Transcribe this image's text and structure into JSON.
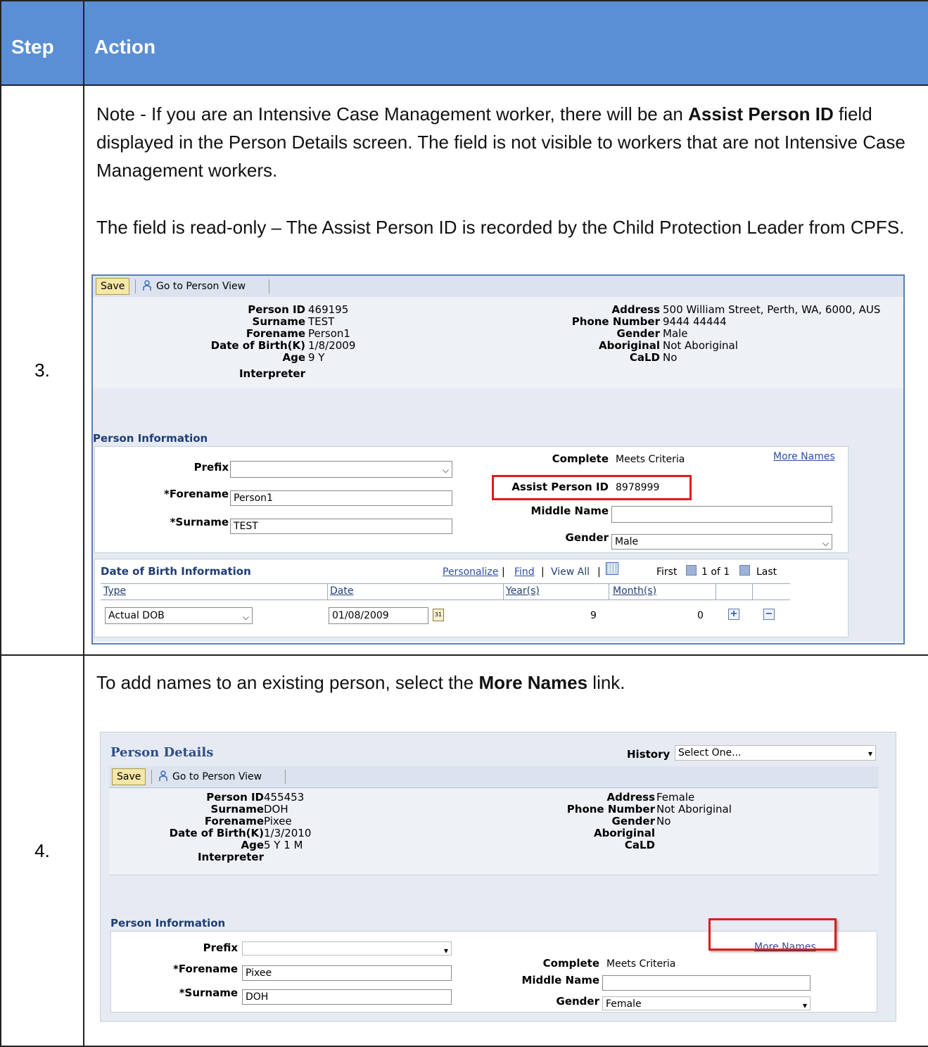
{
  "table": {
    "header_step": "Step",
    "header_action": "Action"
  },
  "row3": {
    "step": "3.",
    "para1_a": "Note - If you are an Intensive Case Management worker, there will be an ",
    "para1_bold": "Assist Person ID",
    "para1_b": " field displayed in the Person Details screen.  The field is not visible to workers that are not Intensive Case Management workers.",
    "para2": "The field is read-only – The Assist Person ID is recorded by the Child Protection Leader from CPFS.",
    "shot": {
      "save": "Save",
      "goto": "Go to Person View",
      "person_id_label": "Person ID",
      "person_id": "469195",
      "surname_label": "Surname",
      "surname": "TEST",
      "forename_label": "Forename",
      "forename": "Person1",
      "dob_label": "Date of Birth(K)",
      "dob": "1/8/2009",
      "age_label": "Age",
      "age": "9 Y",
      "interpreter_label": "Interpreter",
      "address_label": "Address",
      "address": "500 William Street, Perth, WA, 6000, AUS",
      "phone_label": "Phone Number",
      "phone": "9444 44444",
      "gender_label": "Gender",
      "gender": "Male",
      "aboriginal_label": "Aboriginal",
      "aboriginal": "Not Aboriginal",
      "cald_label": "CaLD",
      "cald": "No",
      "person_info_title": "Person Information",
      "prefix_label": "Prefix",
      "prefix_value": "",
      "forename_field_label": "*Forename",
      "forename_field": "Person1",
      "surname_field_label": "*Surname",
      "surname_field": "TEST",
      "complete_label": "Complete",
      "complete_value": "Meets Criteria",
      "more_names": "More Names",
      "assist_label": "Assist Person ID",
      "assist_value": "8978999",
      "middle_label": "Middle Name",
      "middle_value": "",
      "gender_field_label": "Gender",
      "gender_field": "Male",
      "dob_info_title": "Date of Birth Information",
      "personalize": "Personalize",
      "find": "Find",
      "view_all": "View All",
      "first": "First",
      "range": "1 of 1",
      "last": "Last",
      "col_type": "Type",
      "col_date": "Date",
      "col_years": "Year(s)",
      "col_months": "Month(s)",
      "row_type": "Actual DOB",
      "row_date": "01/08/2009",
      "row_years": "9",
      "row_months": "0"
    }
  },
  "row4": {
    "step": "4.",
    "para_a": "To add names to an existing person, select the ",
    "para_bold": "More Names",
    "para_b": " link.",
    "shot": {
      "title": "Person Details",
      "history_label": "History",
      "history_value": "Select One...",
      "save": "Save",
      "goto": "Go to Person View",
      "person_id_label": "Person ID",
      "person_id": "455453",
      "surname_label": "Surname",
      "surname": "DOH",
      "forename_label": "Forename",
      "forename": "Pixee",
      "dob_label": "Date of Birth(K)",
      "dob": "1/3/2010",
      "age_label": "Age",
      "age": "5 Y 1 M",
      "interpreter_label": "Interpreter",
      "address_label": "Address",
      "address": "",
      "phone_label": "Phone Number",
      "phone": "",
      "gender_label": "Gender",
      "gender": "Female",
      "aboriginal_label": "Aboriginal",
      "aboriginal": "Not Aboriginal",
      "cald_label": "CaLD",
      "cald": "No",
      "person_info_title": "Person Information",
      "prefix_label": "Prefix",
      "prefix_value": "",
      "forename_field_label": "*Forename",
      "forename_field": "Pixee",
      "surname_field_label": "*Surname",
      "surname_field": "DOH",
      "complete_label": "Complete",
      "complete_value": "Meets Criteria",
      "more_names": "More Names",
      "middle_label": "Middle Name",
      "middle_value": "",
      "gender_field_label": "Gender",
      "gender_field": "Female"
    }
  },
  "colors": {
    "header_bg": "#5b8fd5",
    "highlight": "#e01b1b",
    "accent_text": "#1e3d75"
  }
}
